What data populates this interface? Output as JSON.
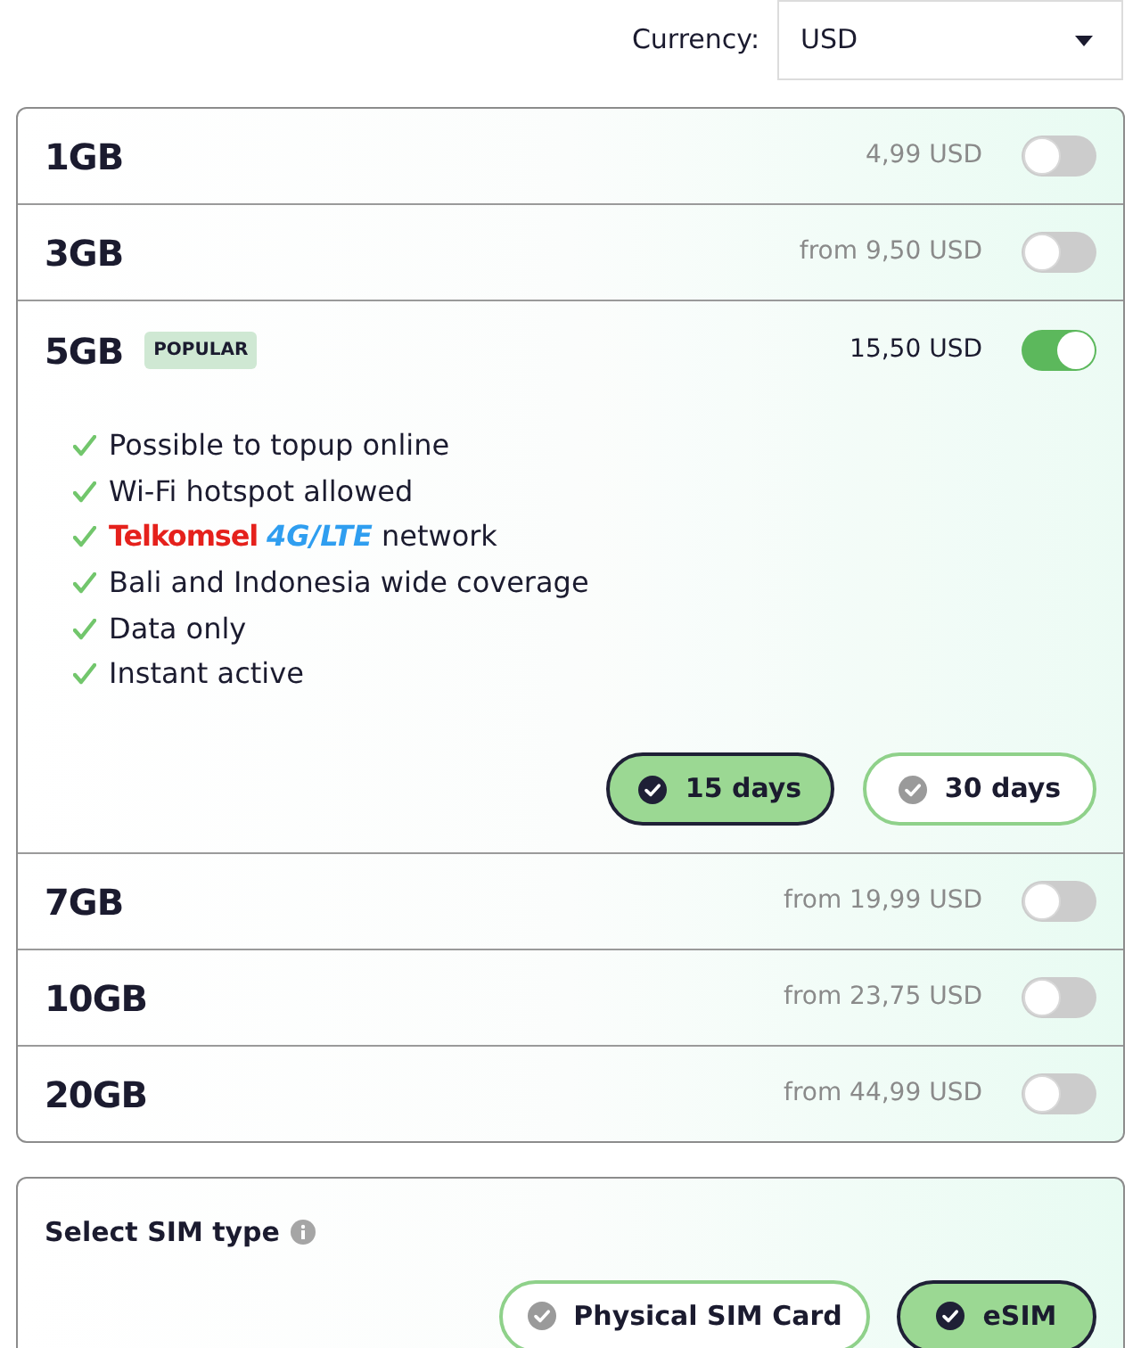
{
  "currency": {
    "label": "Currency:",
    "value": "USD"
  },
  "plans": [
    {
      "name": "1GB",
      "price": "4,99 USD",
      "on": false,
      "expanded": false
    },
    {
      "name": "3GB",
      "price": "from 9,50 USD",
      "on": false,
      "expanded": false
    },
    {
      "name": "5GB",
      "badge": "POPULAR",
      "price": "15,50 USD",
      "on": true,
      "expanded": true,
      "features": [
        {
          "kind": "text",
          "text": "Possible to topup online"
        },
        {
          "kind": "text",
          "text": "Wi-Fi hotspot allowed"
        },
        {
          "kind": "network",
          "brand": "Telkomsel",
          "technology": "4G/LTE",
          "text": "network"
        },
        {
          "kind": "text",
          "text": "Bali and Indonesia wide coverage"
        },
        {
          "kind": "text",
          "text": "Data only"
        },
        {
          "kind": "text",
          "text": "Instant active"
        }
      ],
      "durations": [
        {
          "label": "15 days",
          "selected": true
        },
        {
          "label": "30 days",
          "selected": false
        }
      ]
    },
    {
      "name": "7GB",
      "price": "from 19,99 USD",
      "on": false,
      "expanded": false
    },
    {
      "name": "10GB",
      "price": "from 23,75 USD",
      "on": false,
      "expanded": false
    },
    {
      "name": "20GB",
      "price": "from 44,99 USD",
      "on": false,
      "expanded": false
    }
  ],
  "sim_type": {
    "title": "Select SIM type",
    "options": [
      {
        "label": "Physical SIM Card",
        "selected": false
      },
      {
        "label": "eSIM",
        "selected": true
      }
    ]
  }
}
